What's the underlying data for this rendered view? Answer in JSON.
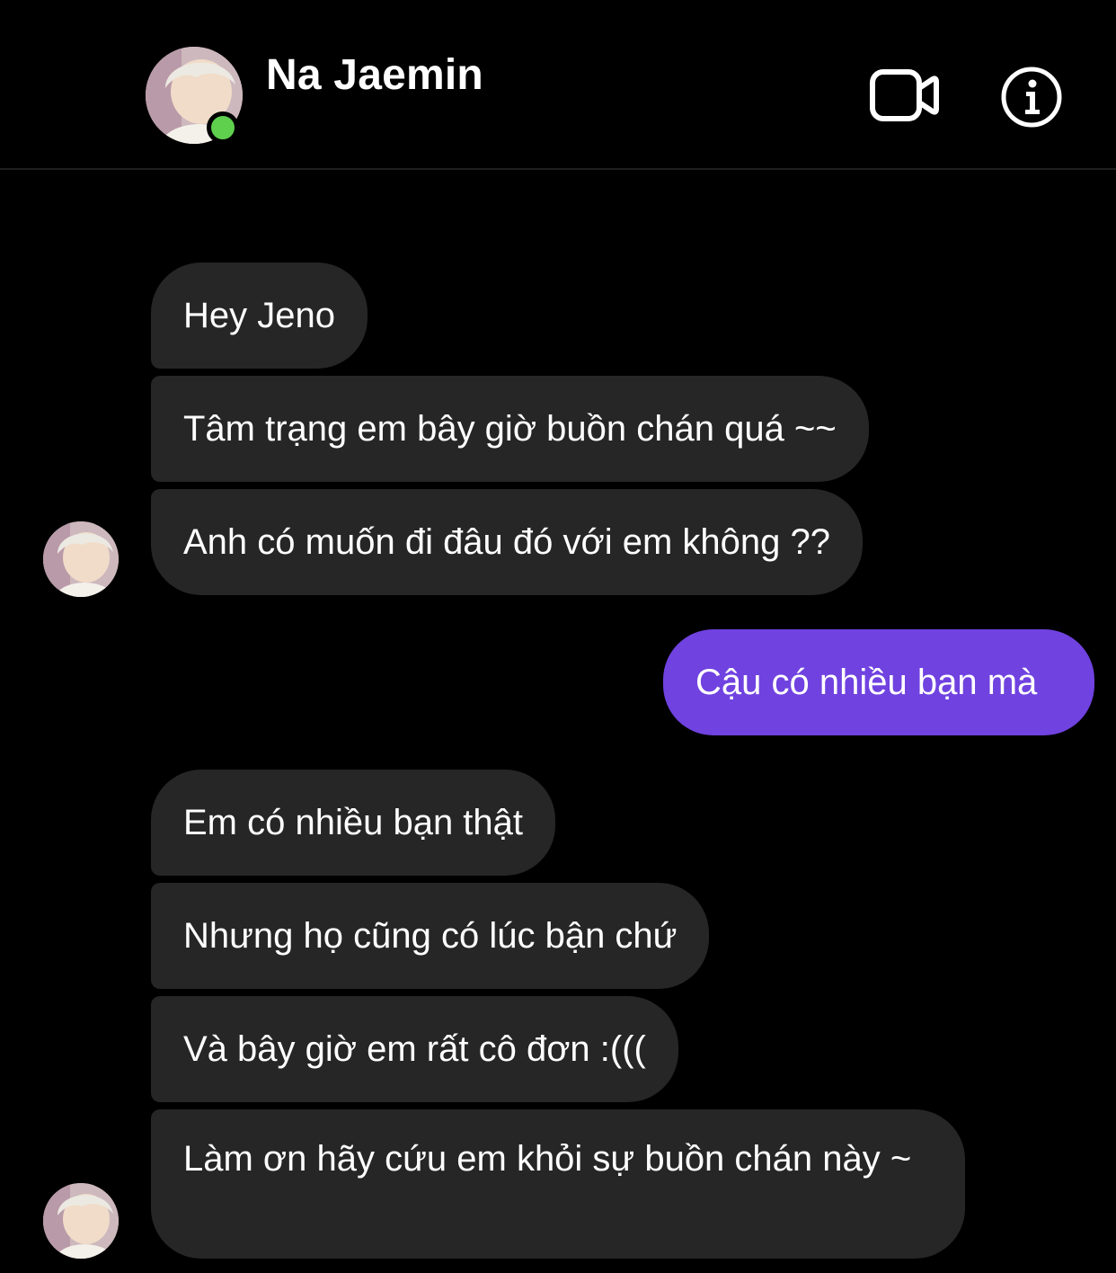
{
  "header": {
    "contact_name": "Na Jaemin",
    "online_status_color": "#5fcf4e",
    "icons": [
      "video-camera-icon",
      "info-icon"
    ]
  },
  "messages": [
    {
      "direction": "incoming",
      "text": "Hey Jeno"
    },
    {
      "direction": "incoming",
      "text": "Tâm trạng em bây giờ buồn chán quá ~~"
    },
    {
      "direction": "incoming",
      "text": "Anh có muốn đi đâu đó với em không ??"
    },
    {
      "direction": "outgoing",
      "text": "Cậu có nhiều bạn mà"
    },
    {
      "direction": "incoming",
      "text": "Em có nhiều bạn thật"
    },
    {
      "direction": "incoming",
      "text": "Nhưng họ cũng có lúc bận chứ"
    },
    {
      "direction": "incoming",
      "text": "Và bây giờ em rất cô đơn :((("
    },
    {
      "direction": "incoming",
      "text": "Làm ơn hãy cứu em khỏi sự buồn chán này ~"
    }
  ],
  "colors": {
    "background": "#000000",
    "incoming_bubble": "#262626",
    "outgoing_bubble": "#7042e0"
  }
}
